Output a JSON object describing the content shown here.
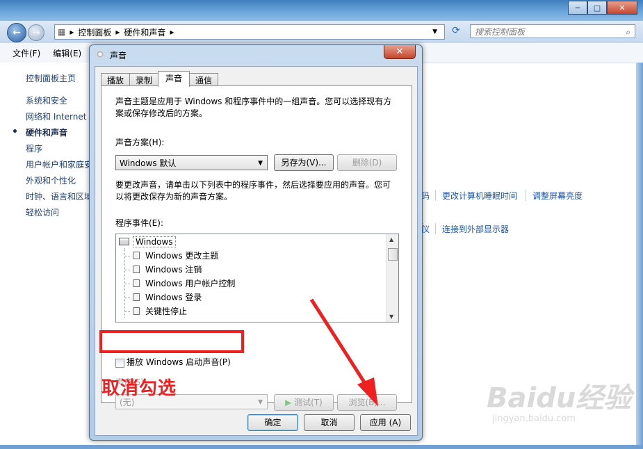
{
  "explorer": {
    "address": [
      "控制面板",
      "硬件和声音"
    ],
    "search_placeholder": "搜索控制面板",
    "menu": [
      "文件(F)",
      "编辑(E)"
    ],
    "nav_items": [
      "控制面板主页",
      "系统和安全",
      "网络和 Internet",
      "硬件和声音",
      "程序",
      "用户帐户和家庭安",
      "外观和个性化",
      "时钟、语言和区域",
      "轻松访问"
    ],
    "links_row1": [
      "码",
      "更改计算机睡眠时间",
      "调整屏幕亮度"
    ],
    "links_row2": [
      "仪",
      "连接到外部显示器"
    ]
  },
  "dialog": {
    "title": "声音",
    "close_label": "✕",
    "tabs": [
      "播放",
      "录制",
      "声音",
      "通信"
    ],
    "description": "声音主题是应用于 Windows 和程序事件中的一组声音。您可以选择现有方案或保存修改后的方案。",
    "scheme_label": "声音方案(H):",
    "scheme_value": "Windows 默认",
    "save_as_label": "另存为(V)...",
    "delete_label": "删除(D)",
    "change_hint": "要更改声音，请单击以下列表中的程序事件，然后选择要应用的声音。您可以将更改保存为新的声音方案。",
    "events_label": "程序事件(E):",
    "events_root": "Windows",
    "events": [
      "Windows 更改主题",
      "Windows 注销",
      "Windows 用户帐户控制",
      "Windows 登录",
      "关键性停止"
    ],
    "startup_checkbox_label": "播放 Windows 启动声音(P)",
    "startup_checked": false,
    "sounds_label": "声音(S):",
    "sounds_value": "(无)",
    "test_label": "测试(T)",
    "browse_label": "浏览(B)...",
    "ok_label": "确定",
    "cancel_label": "取消",
    "apply_label": "应用 (A)"
  },
  "annotation": {
    "text": "取消勾选",
    "color": "#ee2020"
  },
  "watermark": {
    "brand": "Baidu经验",
    "url": "jingyan.baidu.com"
  }
}
